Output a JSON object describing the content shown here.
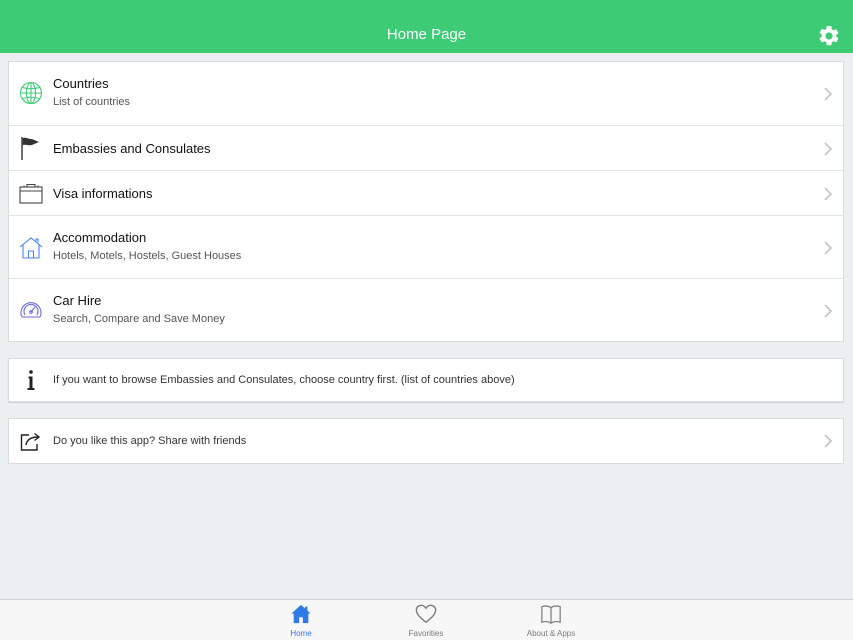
{
  "header": {
    "title": "Home Page",
    "settings_icon": "gear-icon"
  },
  "menu": [
    {
      "title": "Countries",
      "subtitle": "List of countries",
      "icon": "globe-icon"
    },
    {
      "title": "Embassies and Consulates",
      "icon": "flag-icon"
    },
    {
      "title": "Visa informations",
      "icon": "briefcase-icon"
    },
    {
      "title": "Accommodation",
      "subtitle": "Hotels, Motels, Hostels, Guest Houses",
      "icon": "house-icon"
    },
    {
      "title": "Car Hire",
      "subtitle": "Search, Compare and Save Money",
      "icon": "speedometer-icon"
    }
  ],
  "info": {
    "text": "If you want to browse Embassies and Consulates, choose country first. (list of countries above)",
    "icon": "info-icon"
  },
  "share": {
    "text": "Do you like this app? Share with friends",
    "icon": "share-icon"
  },
  "tabs": [
    {
      "label": "Home",
      "icon": "home-icon",
      "active": true
    },
    {
      "label": "Favorities",
      "icon": "heart-icon",
      "active": false
    },
    {
      "label": "About & Apps",
      "icon": "book-icon",
      "active": false
    }
  ],
  "colors": {
    "header": "#3dcb75",
    "active_tab": "#2f7ae5",
    "background": "#eceff0"
  }
}
